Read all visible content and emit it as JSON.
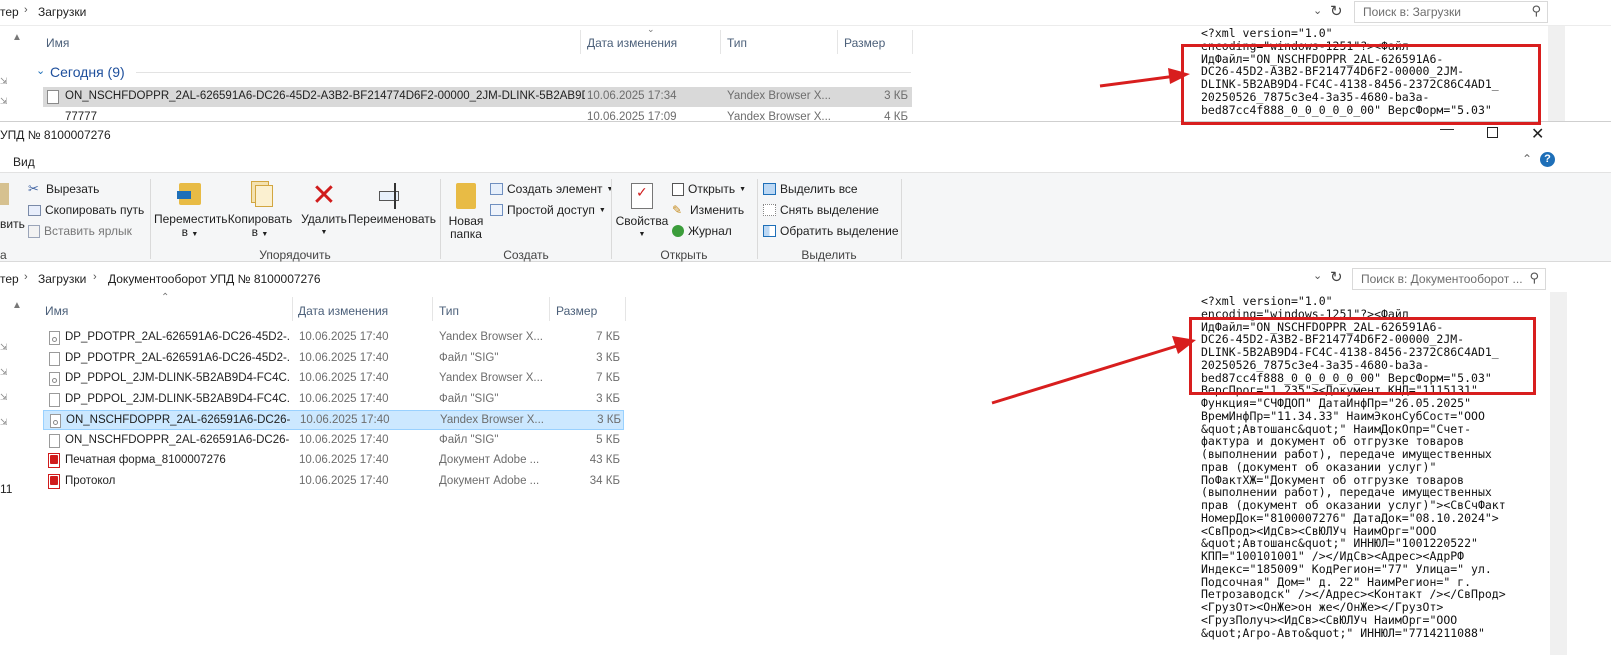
{
  "back_window": {
    "breadcrumb": [
      "тер",
      "Загрузки"
    ],
    "search_placeholder": "Поиск в: Загрузки",
    "columns": [
      "Имя",
      "Дата изменения",
      "Тип",
      "Размер"
    ],
    "group_label": "Сегодня (9)",
    "rows": [
      {
        "name": "ON_NSCHFDOPPR_2AL-626591A6-DC26-45D2-A3B2-BF214774D6F2-00000_2JM-DLINK-5B2AB9D...",
        "date": "10.06.2025 17:34",
        "type": "Yandex Browser X...",
        "size": "3 КБ"
      },
      {
        "name": "77777",
        "date": "10.06.2025 17:09",
        "type": "Yandex Browser X...",
        "size": "4 КБ"
      }
    ]
  },
  "front_window": {
    "title": "УПД № 8100007276",
    "menu_view": "Вид",
    "ribbon": {
      "cut": "Вырезать",
      "copy_path": "Скопировать путь",
      "paste_shortcut": "Вставить ярлык",
      "paste_partial": "вить",
      "clip_partial": "а",
      "move_to": [
        "Переместить",
        "в"
      ],
      "copy_to": [
        "Копировать",
        "в"
      ],
      "delete": "Удалить",
      "rename": "Переименовать",
      "organize_label": "Упорядочить",
      "new_folder": [
        "Новая",
        "папка"
      ],
      "new_item": "Создать элемент",
      "easy_access": "Простой доступ",
      "create_label": "Создать",
      "properties": "Свойства",
      "open": "Открыть",
      "edit": "Изменить",
      "history": "Журнал",
      "open_label": "Открыть",
      "select_all": "Выделить все",
      "select_none": "Снять выделение",
      "invert_selection": "Обратить выделение",
      "select_label": "Выделить"
    },
    "breadcrumb": [
      "тер",
      "Загрузки",
      "Документооборот УПД № 8100007276"
    ],
    "search_placeholder": "Поиск в: Документооборот ...",
    "columns": [
      "Имя",
      "Дата изменения",
      "Тип",
      "Размер"
    ],
    "rows": [
      {
        "name": "DP_PDOTPR_2AL-626591A6-DC26-45D2-...",
        "date": "10.06.2025 17:40",
        "type": "Yandex Browser X...",
        "size": "7 КБ",
        "icon": "xml-file-icon"
      },
      {
        "name": "DP_PDOTPR_2AL-626591A6-DC26-45D2-...",
        "date": "10.06.2025 17:40",
        "type": "Файл \"SIG\"",
        "size": "3 КБ",
        "icon": "file-icon"
      },
      {
        "name": "DP_PDPOL_2JM-DLINK-5B2AB9D4-FC4C...",
        "date": "10.06.2025 17:40",
        "type": "Yandex Browser X...",
        "size": "7 КБ",
        "icon": "xml-file-icon"
      },
      {
        "name": "DP_PDPOL_2JM-DLINK-5B2AB9D4-FC4C...",
        "date": "10.06.2025 17:40",
        "type": "Файл \"SIG\"",
        "size": "3 КБ",
        "icon": "file-icon"
      },
      {
        "name": "ON_NSCHFDOPPR_2AL-626591A6-DC26-...",
        "date": "10.06.2025 17:40",
        "type": "Yandex Browser X...",
        "size": "3 КБ",
        "icon": "xml-file-icon",
        "selected": true
      },
      {
        "name": "ON_NSCHFDOPPR_2AL-626591A6-DC26-...",
        "date": "10.06.2025 17:40",
        "type": "Файл \"SIG\"",
        "size": "5 КБ",
        "icon": "file-icon"
      },
      {
        "name": "Печатная форма_8100007276",
        "date": "10.06.2025 17:40",
        "type": "Документ Adobe ...",
        "size": "43 КБ",
        "icon": "pdf-icon"
      },
      {
        "name": "Протокол",
        "date": "10.06.2025 17:40",
        "type": "Документ Adobe ...",
        "size": "34 КБ",
        "icon": "pdf-icon"
      }
    ]
  },
  "xml_top": "<?xml version=\"1.0\"\nencoding=\"windows-1251\"?><Файл\nИдФайл=\"ON_NSCHFDOPPR_2AL-626591A6-\nDC26-45D2-A3B2-BF214774D6F2-00000_2JM-\nDLINK-5B2AB9D4-FC4C-4138-8456-2372C86C4AD1_\n20250526_7875c3e4-3a35-4680-ba3a-\nbed87cc4f888_0_0_0_0_0_00\" ВерсФорм=\"5.03\"",
  "xml_bottom": "<?xml version=\"1.0\"\nencoding=\"windows-1251\"?><Файл\nИдФайл=\"ON_NSCHFDOPPR_2AL-626591A6-\nDC26-45D2-A3B2-BF214774D6F2-00000_2JM-\nDLINK-5B2AB9D4-FC4C-4138-8456-2372C86C4AD1_\n20250526_7875c3e4-3a35-4680-ba3a-\nbed87cc4f888_0_0_0_0_0_00\" ВерсФорм=\"5.03\"\nВерсПрог=\"1.235\"><Документ КНД=\"1115131\"\nФункция=\"СЧФДОП\" ДатаИнфПр=\"26.05.2025\"\nВремИнфПр=\"11.34.33\" НаимЭконСубСост=\"ООО\n&quot;Автошанс&quot;\" НаимДокОпр=\"Счет-\nфактура и документ об отгрузке товаров\n(выполнении работ), передаче имущественных\nправ (документ об оказании услуг)\"\nПоФактХЖ=\"Документ об отгрузке товаров\n(выполнении работ), передаче имущественных\nправ (документ об оказании услуг)\"><СвСчФакт\nНомерДок=\"8100007276\" ДатаДок=\"08.10.2024\">\n<СвПрод><ИдСв><СвЮЛУч НаимОрг=\"ООО\n&quot;Автошанс&quot;\" ИННЮЛ=\"1001220522\"\nКПП=\"100101001\" /></ИдСв><Адрес><АдрРФ\nИндекс=\"185009\" КодРегион=\"77\" Улица=\" ул.\nПодсочная\" Дом=\" д. 22\" НаимРегион=\" г.\nПетрозаводск\" /></Адрес><Контакт /></СвПрод>\n<ГрузОт><ОнЖе>он же</ОнЖе></ГрузОт>\n<ГрузПолуч><ИдСв><СвЮЛУч НаимОрг=\"ООО\n&quot;Агро-Авто&quot;\" ИННЮЛ=\"7714211088\"",
  "left_edge_digit": "11",
  "colors": {
    "accent": "#1e6fb8",
    "selection": "#cce8ff",
    "annotation_red": "#d81e1e",
    "gray_row": "#d9d9d9"
  }
}
